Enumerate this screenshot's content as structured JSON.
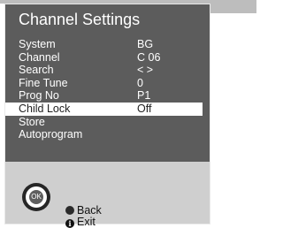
{
  "osd": {
    "title": "Channel Settings",
    "rows": [
      {
        "label": "System",
        "value": "BG"
      },
      {
        "label": "Channel",
        "value": "C 06"
      },
      {
        "label": "Search",
        "value": "< >"
      },
      {
        "label": "Fine Tune",
        "value": "0"
      },
      {
        "label": "Prog No",
        "value": "P1"
      },
      {
        "label": "Child Lock",
        "value": "Off"
      },
      {
        "label": "Store",
        "value": ""
      },
      {
        "label": "Autoprogram",
        "value": ""
      }
    ]
  },
  "remote": {
    "ok_label": "OK",
    "back_label": "Back",
    "exit_label": "Exit",
    "info_glyph": "i"
  }
}
